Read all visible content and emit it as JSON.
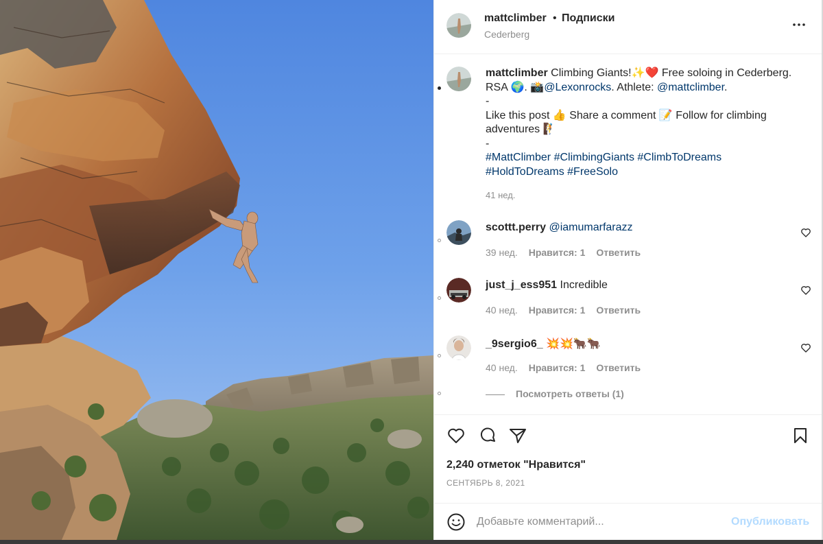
{
  "post": {
    "username": "mattclimber",
    "separator": "•",
    "follow_label": "Подписки",
    "location": "Cederberg",
    "more_icon": "more-horizontal-icon",
    "caption": {
      "username": "mattclimber",
      "line1": " Climbing Giants!✨❤️ Free soloing in Cederberg. RSA 🌍. 📸",
      "mention1": "@Lexonrocks",
      "line1b": ". Athlete: ",
      "mention2": "@mattclimber",
      "line1c": ".",
      "dash1": "-",
      "line2": "Like this post 👍 Share a comment 📝 Follow for climbing adventures 🧗",
      "dash2": "-",
      "hashtags": "#MattClimber #ClimbingGiants #ClimbToDreams #HoldToDreams #FreeSolo",
      "time": "41 нед."
    }
  },
  "comments": [
    {
      "user": "scottt.perry",
      "text": "",
      "mention": "@iamumarfarazz",
      "time": "39 нед.",
      "likes": "Нравится: 1",
      "reply": "Ответить"
    },
    {
      "user": "just_j_ess951",
      "text": " Incredible",
      "mention": "",
      "time": "40 нед.",
      "likes": "Нравится: 1",
      "reply": "Ответить"
    },
    {
      "user": "_9sergio6_",
      "text": " 💥💥🐂🐂",
      "mention": "",
      "time": "40 нед.",
      "likes": "Нравится: 1",
      "reply": "Ответить"
    }
  ],
  "view_replies": "Посмотреть ответы (1)",
  "actions": {
    "like_icon": "heart-icon",
    "comment_icon": "comment-icon",
    "share_icon": "share-icon",
    "save_icon": "bookmark-icon",
    "likes_count": "2,240 отметок \"Нравится\"",
    "date": "СЕНТЯБРЬ 8, 2021"
  },
  "comment_form": {
    "placeholder": "Добавьте комментарий...",
    "publish_label": "Опубликовать",
    "emoji_icon": "emoji-icon"
  },
  "colors": {
    "text": "#262626",
    "muted": "#8e8e8e",
    "link": "#00376b",
    "publish_disabled": "#b3dbff"
  }
}
